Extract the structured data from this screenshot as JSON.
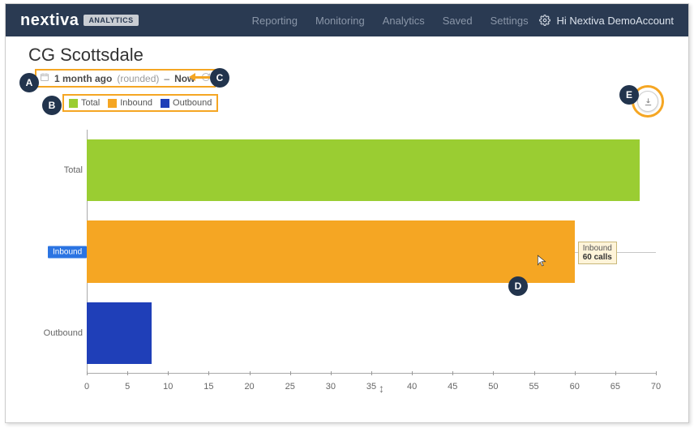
{
  "brand": {
    "name": "nextiva",
    "badge": "ANALYTICS"
  },
  "nav": [
    "Reporting",
    "Monitoring",
    "Analytics",
    "Saved",
    "Settings"
  ],
  "user_greeting": "Hi Nextiva DemoAccount",
  "title": "CG Scottsdale",
  "daterange": {
    "start": "1 month ago",
    "rounded": "(rounded)",
    "dash": "–",
    "end": "Now"
  },
  "legend": [
    {
      "label": "Total",
      "color": "#9acd32"
    },
    {
      "label": "Inbound",
      "color": "#f5a623"
    },
    {
      "label": "Outbound",
      "color": "#1f3fb8"
    }
  ],
  "annotations": {
    "A": "A",
    "B": "B",
    "C": "C",
    "D": "D",
    "E": "E"
  },
  "tooltip": {
    "series": "Inbound",
    "value": "60 calls"
  },
  "chart_data": {
    "type": "bar",
    "orientation": "horizontal",
    "categories": [
      "Total",
      "Inbound",
      "Outbound"
    ],
    "values": [
      68,
      60,
      8
    ],
    "colors": [
      "#9acd32",
      "#f5a623",
      "#1f3fb8"
    ],
    "xlabel": "",
    "ylabel": "",
    "xlim": [
      0,
      70
    ],
    "xticks": [
      0,
      5,
      10,
      15,
      20,
      25,
      30,
      35,
      40,
      45,
      50,
      55,
      60,
      65,
      70
    ]
  }
}
